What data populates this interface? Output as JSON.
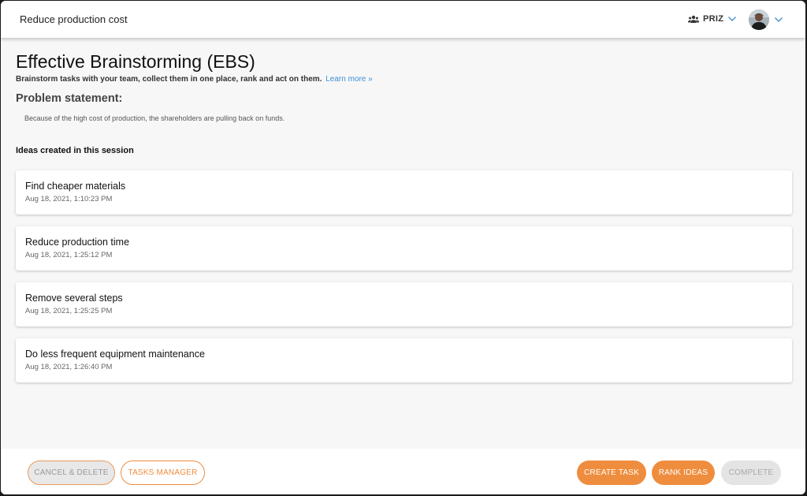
{
  "header": {
    "title": "Reduce production cost",
    "team_name": "PRIZ",
    "icons": {
      "team": "people-icon",
      "team_chevron": "chevron-down-icon",
      "user_chevron": "chevron-down-icon"
    },
    "accent_color": "#4a90c8"
  },
  "page": {
    "title": "Effective Brainstorming (EBS)",
    "subtitle": "Brainstorm tasks with your team, collect them in one place, rank and act on them.",
    "learn_more": "Learn more »",
    "problem_heading": "Problem statement:",
    "problem_text": "Because of the high cost of production, the shareholders are pulling back on funds.",
    "ideas_heading": "Ideas created in this session"
  },
  "ideas": [
    {
      "title": "Find cheaper materials",
      "date": "Aug 18, 2021, 1:10:23 PM"
    },
    {
      "title": "Reduce production time",
      "date": "Aug 18, 2021, 1:25:12 PM"
    },
    {
      "title": "Remove several steps",
      "date": "Aug 18, 2021, 1:25:25 PM"
    },
    {
      "title": "Do less frequent equipment maintenance",
      "date": "Aug 18, 2021, 1:26:40 PM"
    }
  ],
  "footer": {
    "cancel_delete": "CANCEL & DELETE",
    "tasks_manager": "TASKS MANAGER",
    "create_task": "CREATE TASK",
    "rank_ideas": "RANK IDEAS",
    "complete": "COMPLETE"
  },
  "colors": {
    "primary_orange": "#ef8d3e",
    "link_blue": "#3d8fd6",
    "disabled_gray": "#e4e4e4"
  }
}
